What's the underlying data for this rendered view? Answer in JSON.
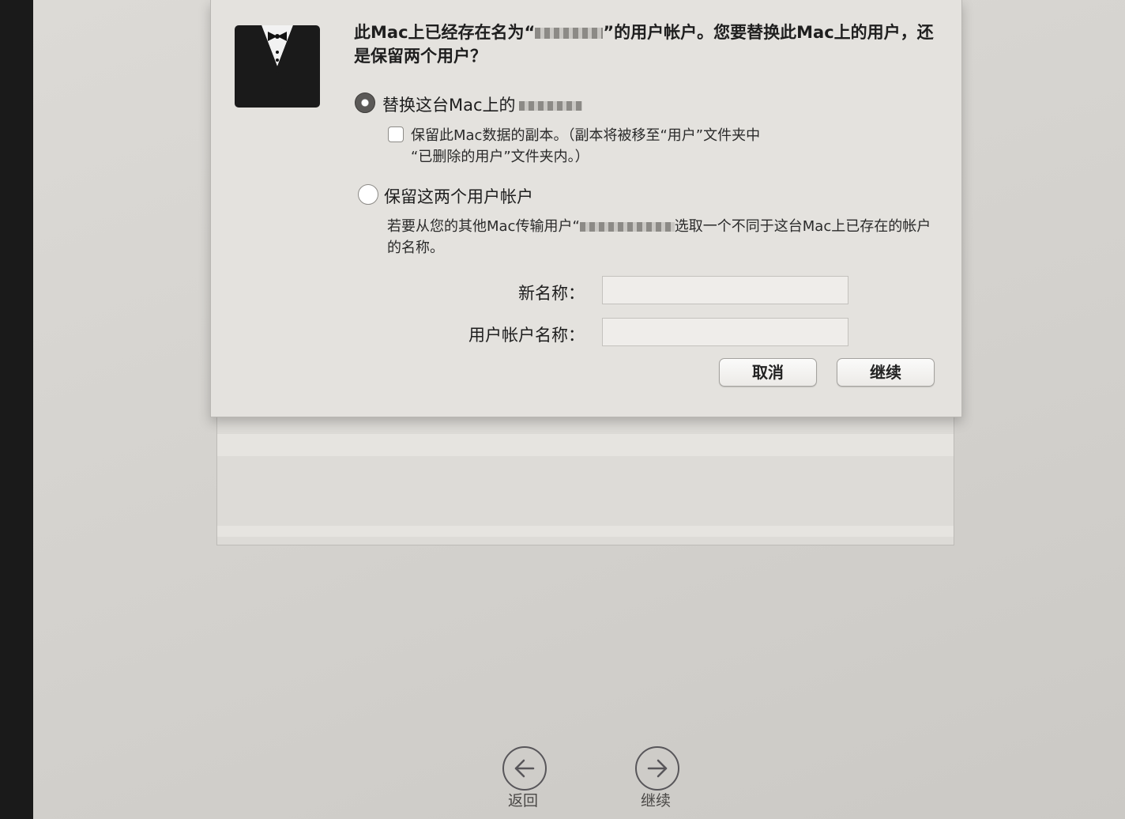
{
  "dialog": {
    "message": "此Mac上已经存在名为“ ”的用户帐户。您要替换此Mac上的用户，还是保留两个用户？",
    "message_part1": "此Mac上已经存在名为“",
    "message_part2": "”的用户帐户。您要替换此Mac上的用户，还是保留两个用户？",
    "option_replace": {
      "label": "替换这台Mac上的",
      "selected": true,
      "keep_copy_checkbox": {
        "checked": false,
        "text_line1": "保留此Mac数据的副本。（副本将被移至“用户”文件夹中",
        "text_line2": "“已删除的用户”文件夹内。）"
      }
    },
    "option_keep_both": {
      "label": "保留这两个用户帐户",
      "selected": false,
      "description_part1": "若要从您的其他Mac传输用户“",
      "description_part2": "选取一个不同于这台Mac上已存在的帐户的名称。"
    },
    "fields": {
      "new_name_label": "新名称：",
      "new_name_value": "",
      "account_name_label": "用户帐户名称：",
      "account_name_value": ""
    },
    "buttons": {
      "cancel": "取消",
      "continue": "继续"
    }
  },
  "footer": {
    "back_label": "返回",
    "continue_label": "继续"
  },
  "icon_names": [
    "migration-assistant-tuxedo-icon",
    "back-arrow-icon",
    "forward-arrow-icon"
  ]
}
